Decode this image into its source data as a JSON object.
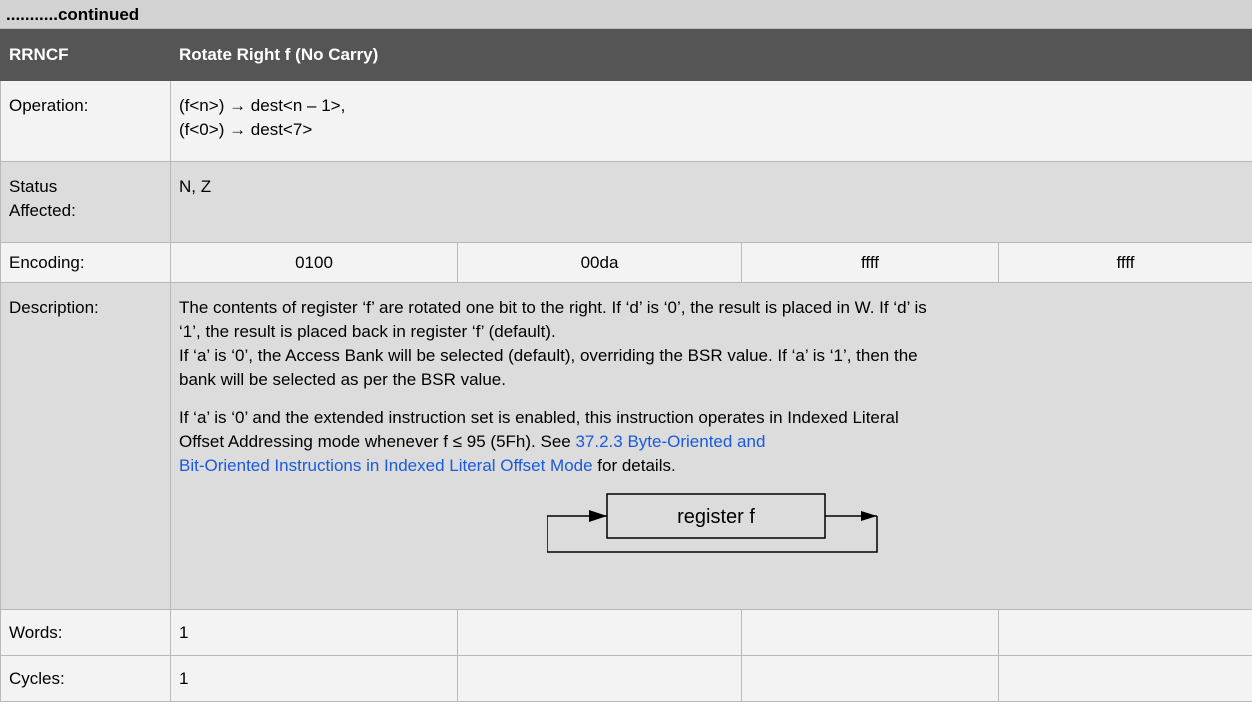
{
  "continued": "...........continued",
  "header": {
    "mnemonic": "RRNCF",
    "title": "Rotate Right f (No Carry)"
  },
  "rows": {
    "operation": {
      "label": "Operation:",
      "lines": [
        "(f<n>) → dest<n – 1>,",
        "(f<0>) → dest<7>"
      ]
    },
    "status": {
      "label_lines": [
        "Status",
        "Affected:"
      ],
      "value": "N, Z"
    },
    "encoding": {
      "label": "Encoding:",
      "fields": [
        "0100",
        "00da",
        "ffff",
        "ffff"
      ]
    },
    "description": {
      "label": "Description:",
      "p1_line1": "The contents of register ‘f’ are rotated one bit to the right. If ‘d’ is ‘0’, the result is placed in W. If ‘d’ is",
      "p1_line2": "‘1’, the result is placed back in register ‘f’ (default).",
      "p1_line3": "If ‘a’ is ‘0’, the Access Bank will be selected (default), overriding the BSR value. If ‘a’ is ‘1’, then the",
      "p1_line4": "bank will be selected as per the BSR value.",
      "p2_line1": "If ‘a’ is ‘0’ and the extended instruction set is enabled, this instruction operates in Indexed Literal",
      "p2_line2_text": "Offset Addressing mode whenever f ≤ 95 (5Fh). See ",
      "p2_link_line1": "37.2.3  Byte-Oriented and",
      "p2_link_line2": "Bit-Oriented Instructions in Indexed Literal Offset Mode",
      "p2_tail": " for details.",
      "diagram_label": "register f"
    },
    "words": {
      "label": "Words:",
      "value": "1"
    },
    "cycles": {
      "label": "Cycles:",
      "value": "1"
    }
  },
  "colors": {
    "header_bg": "#555555",
    "link": "#1a5adc",
    "row_light": "#f3f3f3",
    "row_dark": "#dcdcdc"
  }
}
